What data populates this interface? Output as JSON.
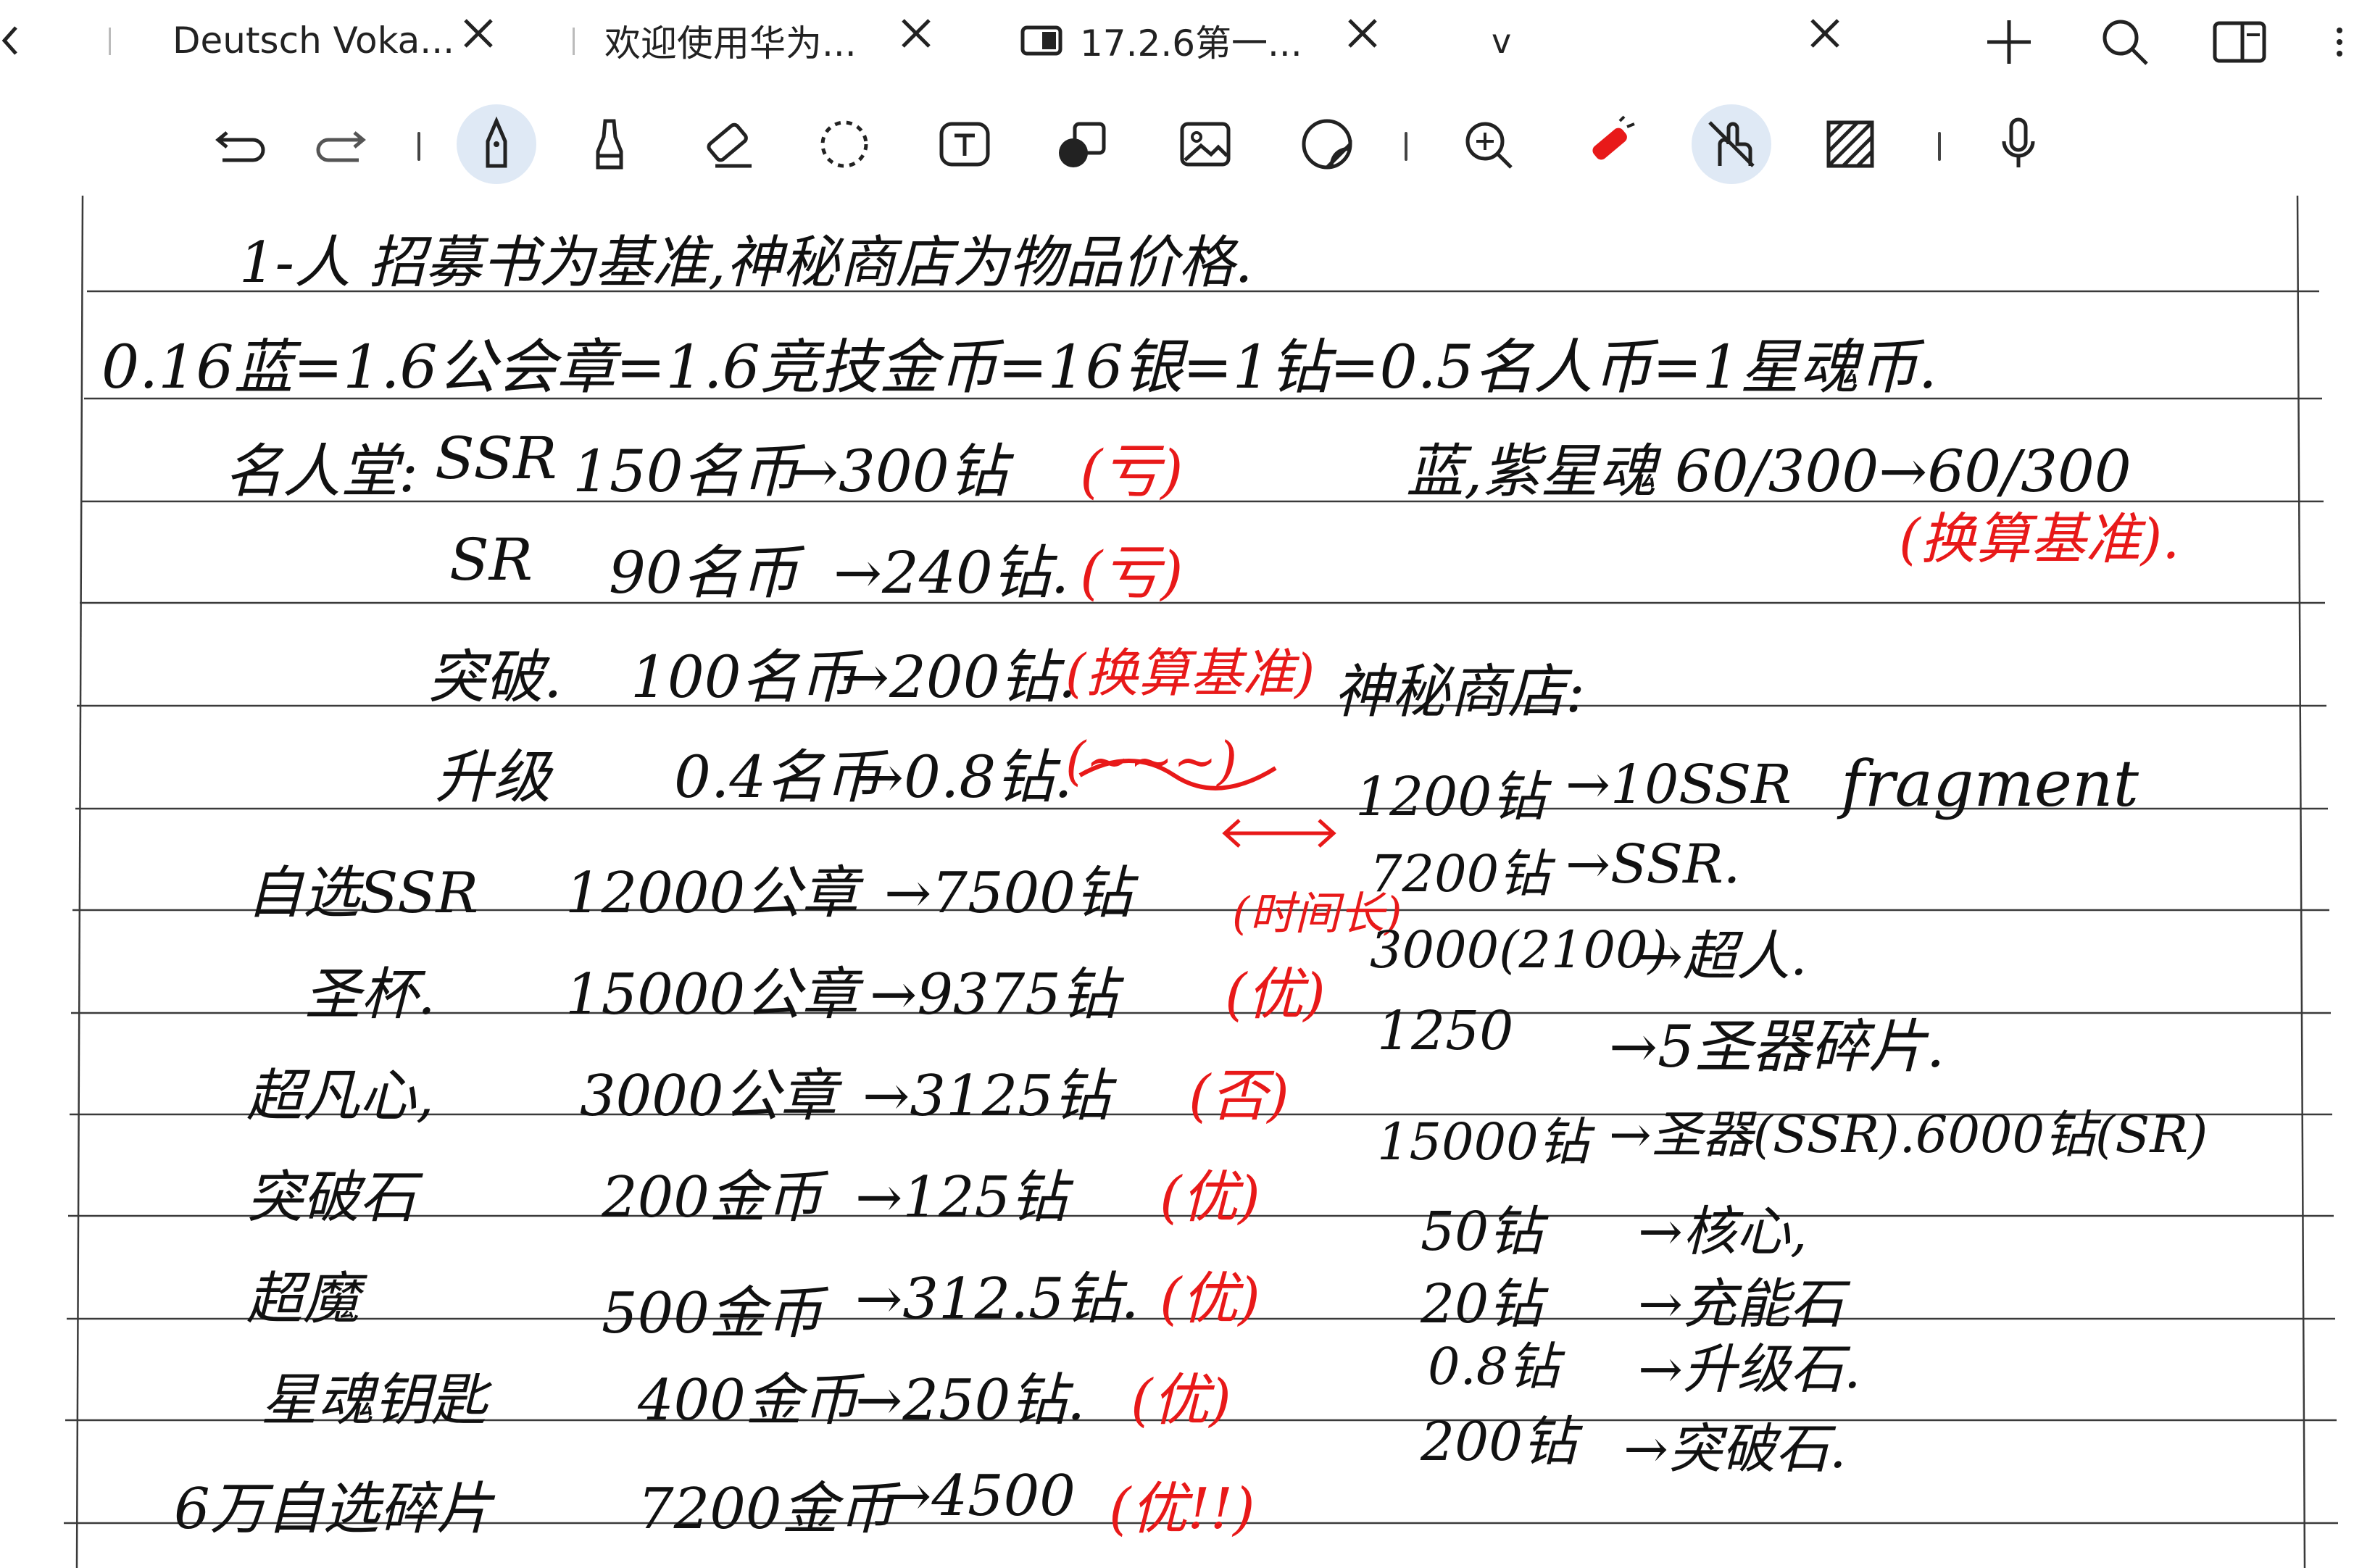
{
  "tabs": [
    {
      "title": "Deutsch Voka...",
      "icon": "none"
    },
    {
      "title": "欢迎使用华为...",
      "icon": "none"
    },
    {
      "title": "17.2.6第一...",
      "icon": "document-tab-icon"
    }
  ],
  "tab_dropdown_label": "v",
  "tab_actions": [
    "close-all-icon",
    "new-tab-icon",
    "search-icon",
    "split-view-icon"
  ],
  "toolbar": {
    "tools": [
      "undo-icon",
      "redo-icon",
      "pen-icon",
      "highlighter-icon",
      "eraser-icon",
      "lasso-icon",
      "text-icon",
      "shape-icon",
      "image-icon",
      "sticker-icon",
      "zoom-icon",
      "laser-pointer-icon",
      "hand-touch-icon",
      "background-grid-icon",
      "microphone-icon"
    ],
    "active_tools": [
      "pen-icon",
      "hand-touch-icon"
    ]
  },
  "note": {
    "colors": {
      "ink": "#111111",
      "red_ink": "#e81919",
      "ruled_line": "#3a3a3a"
    },
    "lines": {
      "title": "1-人 招募书为基准,神秘商店为物品价格.",
      "exchange_rate": "0.16蓝=1.6公会章=1.6竞技金币=16银=1钻=0.5名人币=1星魂币.",
      "hall_label": "名人堂:",
      "hall_rows": [
        {
          "item": "SSR",
          "cost": "150名币",
          "value": "→300钻",
          "note": "(亏)"
        },
        {
          "item": "SR",
          "cost": "90名币",
          "value": "→240钻.",
          "note": "(亏)"
        },
        {
          "item": "突破.",
          "cost": "100名币",
          "value": "→200钻.",
          "note": "(换算基准)"
        },
        {
          "item": "升级",
          "cost": "0.4名币",
          "value": "→0.8钻.",
          "note": "(~~~)"
        }
      ],
      "soul_line": "蓝,紫星魂 60/300→60/300",
      "soul_note": "(换算基准).",
      "shop_label": "神秘商店:",
      "guild_rows": [
        {
          "item": "自选SSR",
          "cost": "12000公章",
          "value": "→7500钻",
          "note": "(时间长)"
        },
        {
          "item": "圣杯.",
          "cost": "15000公章",
          "value": "→9375钻",
          "note": "(优)"
        },
        {
          "item": "超凡心,",
          "cost": "3000公章",
          "value": "→3125钻",
          "note": "(否)"
        },
        {
          "item": "突破石",
          "cost": "200金币",
          "value": "→125钻",
          "note": "(优)"
        },
        {
          "item": "超魔",
          "cost": "500金币",
          "value": "→312.5钻.",
          "note": "(优)"
        },
        {
          "item": "星魂钥匙",
          "cost": "400金币",
          "value": "→250钻.",
          "note": "(优)"
        },
        {
          "item": "6万自选碎片",
          "cost": "7200金币",
          "value": "→4500",
          "note": "(优!!)"
        }
      ],
      "shop_rows": [
        {
          "cost": "1200钻",
          "value": "→10SSR",
          "extra": "fragment"
        },
        {
          "cost": "7200钻",
          "value": "→SSR.",
          "extra": ""
        },
        {
          "cost": "3000(2100)",
          "value": "→超人.",
          "extra": ""
        },
        {
          "cost": "1250",
          "value": "→5圣器碎片.",
          "extra": ""
        },
        {
          "cost": "15000钻",
          "value": "→圣器(SSR).6000钻(SR)",
          "extra": ""
        },
        {
          "cost": "50钻",
          "value": "→核心,",
          "extra": ""
        },
        {
          "cost": "20钻",
          "value": "→充能石",
          "extra": ""
        },
        {
          "cost": "0.8钻",
          "value": "→升级石.",
          "extra": ""
        },
        {
          "cost": "200钻",
          "value": "→突破石.",
          "extra": ""
        }
      ]
    }
  }
}
